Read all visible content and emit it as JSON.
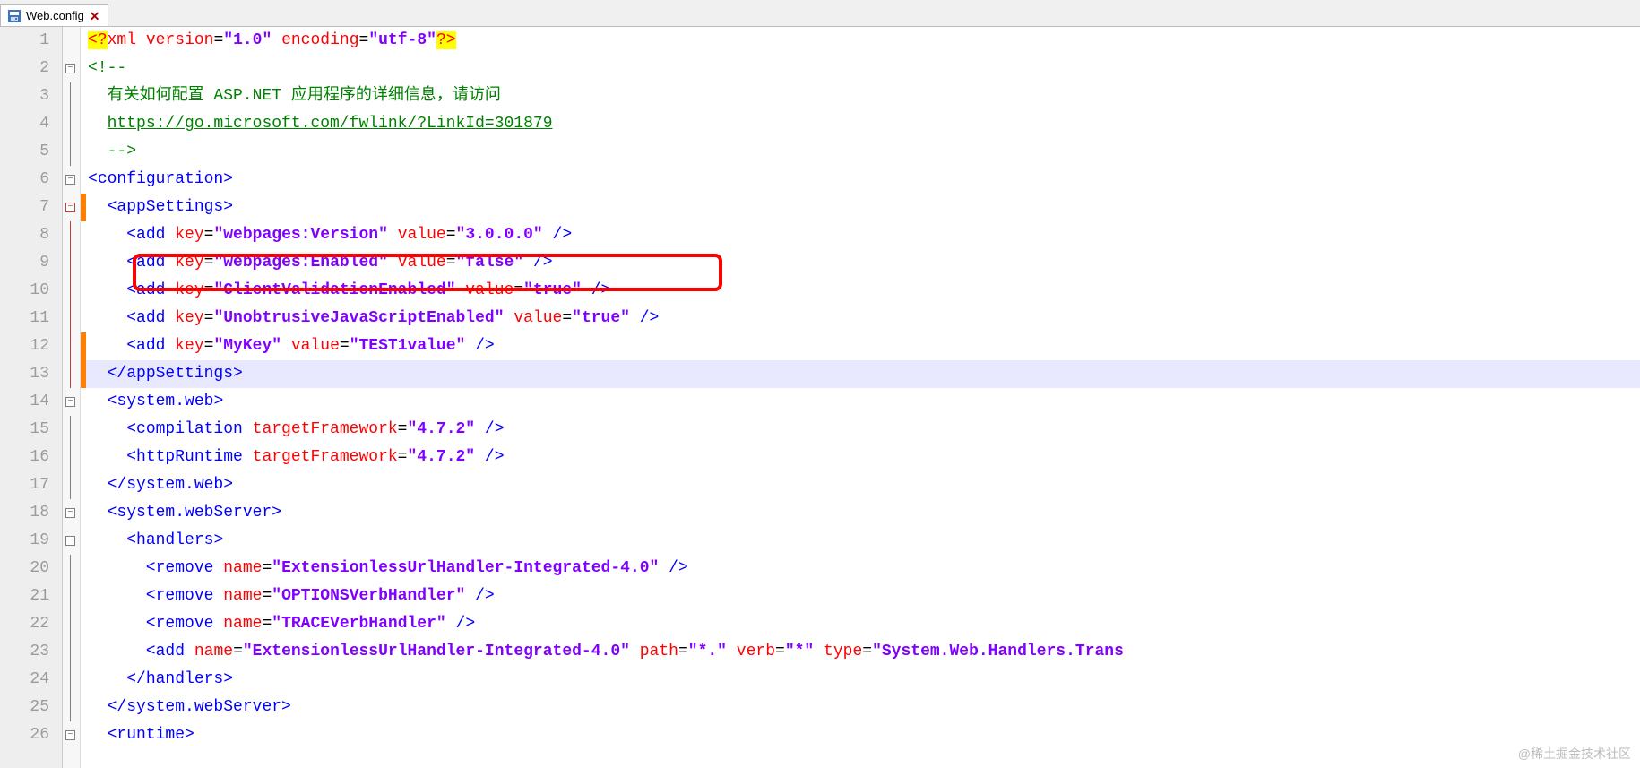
{
  "tab": {
    "title": "Web.config"
  },
  "watermark": "@稀土掘金技术社区",
  "lines": {
    "lineNumbers": [
      "1",
      "2",
      "3",
      "4",
      "5",
      "6",
      "7",
      "8",
      "9",
      "10",
      "11",
      "12",
      "13",
      "14",
      "15",
      "16",
      "17",
      "18",
      "19",
      "20",
      "21",
      "22",
      "23",
      "24",
      "25",
      "26"
    ],
    "highlightRow": 13,
    "changedRows": [
      7,
      12,
      13
    ]
  },
  "code": {
    "l1": {
      "a": "<?",
      "b": "xml ",
      "c": "version",
      "d": "=",
      "e": "\"1.0\"",
      "f": " encoding",
      "g": "=",
      "h": "\"utf-8\"",
      "i": "?>"
    },
    "l2": {
      "a": "<!--"
    },
    "l3": {
      "a": "  有关如何配置 ASP.NET 应用程序的详细信息，请访问"
    },
    "l4": {
      "a": "  ",
      "b": "https://go.microsoft.com/fwlink/?LinkId=301879"
    },
    "l5": {
      "a": "  -->"
    },
    "l6": {
      "a": "<",
      "b": "configuration",
      "c": ">"
    },
    "l7": {
      "a": "  <",
      "b": "appSettings",
      "c": ">"
    },
    "l8": {
      "a": "    <",
      "b": "add ",
      "c": "key",
      "d": "=",
      "e": "\"webpages:Version\"",
      "f": " value",
      "g": "=",
      "h": "\"3.0.0.0\"",
      "i": " />"
    },
    "l9": {
      "a": "    <",
      "b": "add ",
      "c": "key",
      "d": "=",
      "e": "\"webpages:Enabled\"",
      "f": " value",
      "g": "=",
      "h": "\"false\"",
      "i": " />"
    },
    "l10": {
      "a": "    <",
      "b": "add ",
      "c": "key",
      "d": "=",
      "e": "\"ClientValidationEnabled\"",
      "f": " value",
      "g": "=",
      "h": "\"true\"",
      "i": " />"
    },
    "l11": {
      "a": "    <",
      "b": "add ",
      "c": "key",
      "d": "=",
      "e": "\"UnobtrusiveJavaScriptEnabled\"",
      "f": " value",
      "g": "=",
      "h": "\"true\"",
      "i": " />"
    },
    "l12": {
      "a": "    <",
      "b": "add ",
      "c": "key",
      "d": "=",
      "e": "\"MyKey\"",
      "f": " value",
      "g": "=",
      "h": "\"TEST1value\"",
      "i": " />"
    },
    "l13": {
      "a": "  </",
      "b": "appSettings",
      "c": ">"
    },
    "l14": {
      "a": "  <",
      "b": "system.web",
      "c": ">"
    },
    "l15": {
      "a": "    <",
      "b": "compilation ",
      "c": "targetFramework",
      "d": "=",
      "e": "\"4.7.2\"",
      "f": " />"
    },
    "l16": {
      "a": "    <",
      "b": "httpRuntime ",
      "c": "targetFramework",
      "d": "=",
      "e": "\"4.7.2\"",
      "f": " />"
    },
    "l17": {
      "a": "  </",
      "b": "system.web",
      "c": ">"
    },
    "l18": {
      "a": "  <",
      "b": "system.webServer",
      "c": ">"
    },
    "l19": {
      "a": "    <",
      "b": "handlers",
      "c": ">"
    },
    "l20": {
      "a": "      <",
      "b": "remove ",
      "c": "name",
      "d": "=",
      "e": "\"ExtensionlessUrlHandler-Integrated-4.0\"",
      "f": " />"
    },
    "l21": {
      "a": "      <",
      "b": "remove ",
      "c": "name",
      "d": "=",
      "e": "\"OPTIONSVerbHandler\"",
      "f": " />"
    },
    "l22": {
      "a": "      <",
      "b": "remove ",
      "c": "name",
      "d": "=",
      "e": "\"TRACEVerbHandler\"",
      "f": " />"
    },
    "l23": {
      "a": "      <",
      "b": "add ",
      "c": "name",
      "d": "=",
      "e": "\"ExtensionlessUrlHandler-Integrated-4.0\"",
      "f": " path",
      "g": "=",
      "h": "\"*.\"",
      "i": " verb",
      "j": "=",
      "k": "\"*\"",
      "l": " type",
      "m": "=",
      "n": "\"System.Web.Handlers.Trans"
    },
    "l24": {
      "a": "    </",
      "b": "handlers",
      "c": ">"
    },
    "l25": {
      "a": "  </",
      "b": "system.webServer",
      "c": ">"
    },
    "l26": {
      "a": "  <",
      "b": "runtime",
      "c": ">"
    }
  }
}
